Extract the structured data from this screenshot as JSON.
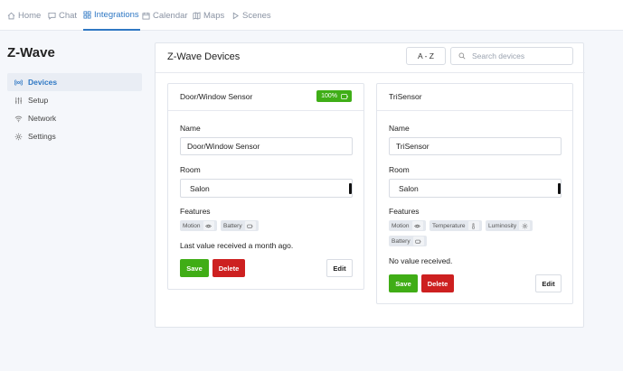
{
  "nav": {
    "tabs": [
      {
        "label": "Home",
        "icon": "home-icon"
      },
      {
        "label": "Chat",
        "icon": "chat-icon"
      },
      {
        "label": "Integrations",
        "icon": "grid-icon",
        "active": true
      },
      {
        "label": "Calendar",
        "icon": "calendar-icon"
      },
      {
        "label": "Maps",
        "icon": "map-icon"
      },
      {
        "label": "Scenes",
        "icon": "play-icon"
      }
    ]
  },
  "sidebar": {
    "title": "Z-Wave",
    "items": [
      {
        "label": "Devices",
        "icon": "radio-icon",
        "active": true
      },
      {
        "label": "Setup",
        "icon": "sliders-icon"
      },
      {
        "label": "Network",
        "icon": "wifi-icon"
      },
      {
        "label": "Settings",
        "icon": "gear-icon"
      }
    ]
  },
  "main": {
    "title": "Z-Wave Devices",
    "sort_label": "A - Z",
    "search_placeholder": "Search devices"
  },
  "labels": {
    "name": "Name",
    "room": "Room",
    "features": "Features",
    "save": "Save",
    "delete": "Delete",
    "edit": "Edit"
  },
  "devices": [
    {
      "title": "Door/Window Sensor",
      "battery": "100%",
      "name_value": "Door/Window Sensor",
      "room_value": "Salon",
      "features": [
        {
          "label": "Motion",
          "icon": "eye-icon"
        },
        {
          "label": "Battery",
          "icon": "battery-icon"
        }
      ],
      "status": "Last value received a month ago."
    },
    {
      "title": "TriSensor",
      "name_value": "TriSensor",
      "room_value": "Salon",
      "features": [
        {
          "label": "Motion",
          "icon": "eye-icon"
        },
        {
          "label": "Temperature",
          "icon": "thermometer-icon"
        },
        {
          "label": "Luminosity",
          "icon": "sun-icon"
        },
        {
          "label": "Battery",
          "icon": "battery-icon"
        }
      ],
      "status": "No value received."
    }
  ],
  "colors": {
    "accent": "#2f78c4",
    "save": "#40ad16",
    "delete": "#cd2020",
    "battery_badge": "#3fae17"
  }
}
